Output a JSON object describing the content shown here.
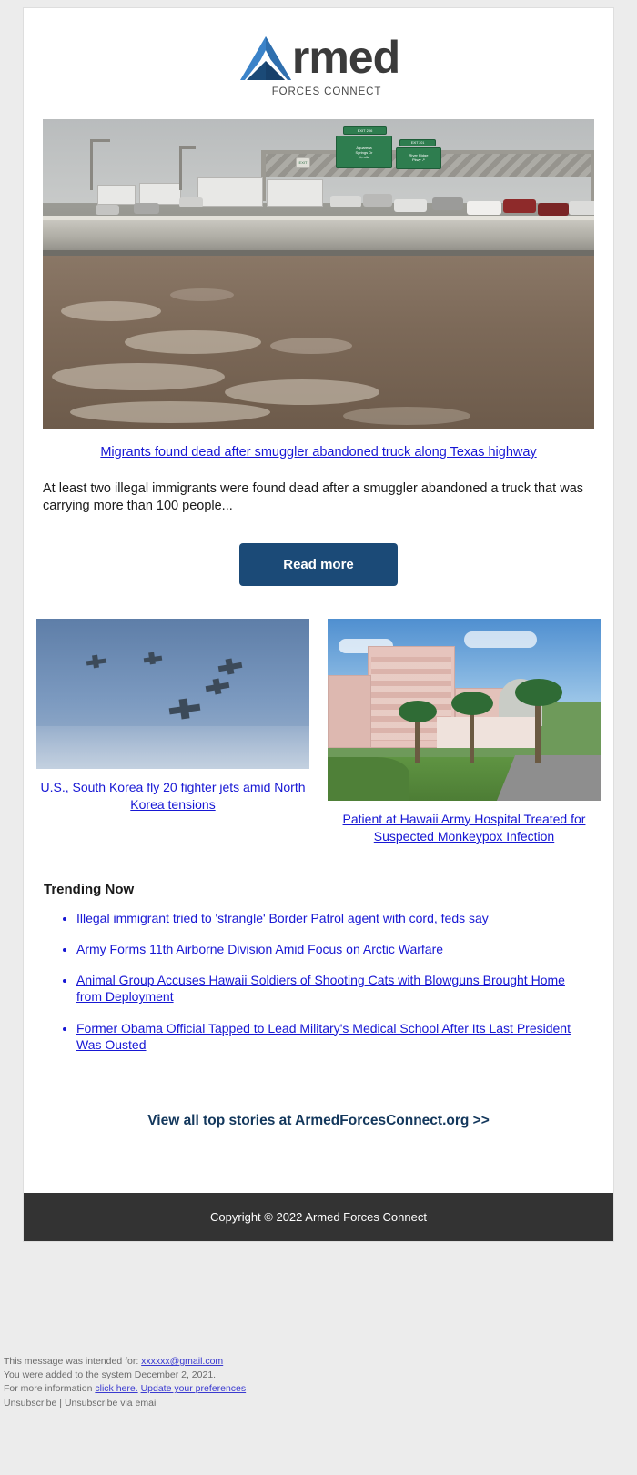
{
  "brand": {
    "logo_word": "rmed",
    "logo_sub": "FORCES CONNECT",
    "logo_icon": "armed-forces-connect-triangle-logo",
    "accent_navy": "#1b4a77",
    "link_blue": "#1717d4",
    "footer_dark": "#333333"
  },
  "hero": {
    "image_alt": "flooded-highway-traffic-photo",
    "headline": "Migrants found dead after smuggler abandoned truck along Texas highway",
    "body": "At least two illegal immigrants were found dead after a smuggler abandoned a truck that was carrying more than 100 people...",
    "cta_label": "Read more",
    "road_signs": [
      {
        "line1": "EXIT 206",
        "line2": "Aquarena",
        "line3": "Springs Dr",
        "line4": "¾ mile"
      },
      {
        "line1": "EXIT 201",
        "line2": "River Ridge",
        "line3": "Pkwy"
      }
    ]
  },
  "stories": [
    {
      "image_alt": "fighter-jets-formation-photo",
      "headline": "U.S., South Korea fly 20 fighter jets amid North Korea tensions"
    },
    {
      "image_alt": "hawaii-army-hospital-photo",
      "headline": "Patient at Hawaii Army Hospital Treated for Suspected Monkeypox Infection"
    }
  ],
  "trending": {
    "title": "Trending Now",
    "items": [
      "Illegal immigrant tried to 'strangle' Border Patrol agent with cord, feds say",
      "Army Forms 11th Airborne Division Amid Focus on Arctic Warfare",
      "Animal Group Accuses Hawaii Soldiers of Shooting Cats with Blowguns Brought Home from Deployment",
      "Former Obama Official Tapped to Lead Military's Medical School After Its Last President Was Ousted"
    ]
  },
  "view_all": {
    "label": "View all top stories at ArmedForcesConnect.org >>"
  },
  "copyright": {
    "text": "Copyright © 2022 Armed Forces Connect"
  },
  "fine_print": {
    "line1_prefix": "This message was intended for: ",
    "line1_email": "xxxxxx@gmail.com",
    "line2": "You were added to the system December 2, 2021.",
    "line3_prefix": "For more information ",
    "line3_link1": "click here.",
    "line3_link2": "Update your preferences",
    "line4_link1": "Unsubscribe",
    "line4_sep": " | ",
    "line4_link2": "Unsubscribe via email"
  }
}
